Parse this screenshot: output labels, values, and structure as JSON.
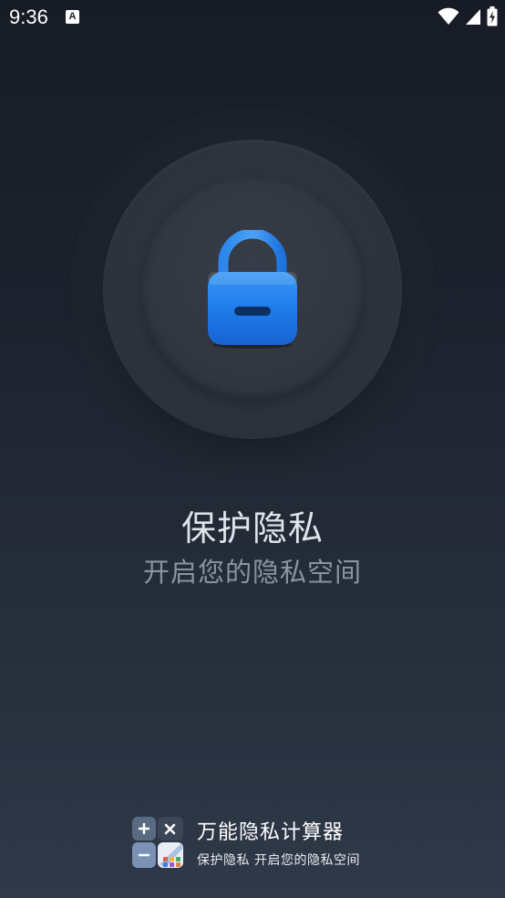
{
  "status_bar": {
    "time": "9:36",
    "notification_icon": "a-notification-icon",
    "wifi_icon": "wifi-icon",
    "signal_icon": "cell-signal-icon",
    "battery_icon": "battery-charging-icon"
  },
  "hero": {
    "lock_icon": "lock-icon",
    "title": "保护隐私",
    "subtitle": "开启您的隐私空间"
  },
  "footer": {
    "logo_icon": "calculator-app-logo-icon",
    "app_name": "万能隐私计算器",
    "tagline": "保护隐私  开启您的隐私空间"
  },
  "colors": {
    "background_top": "#171b25",
    "background_bottom": "#303949",
    "lock_blue": "#1f7bea",
    "title_text": "#dfe3ea",
    "subtitle_text": "#8a93a3"
  }
}
